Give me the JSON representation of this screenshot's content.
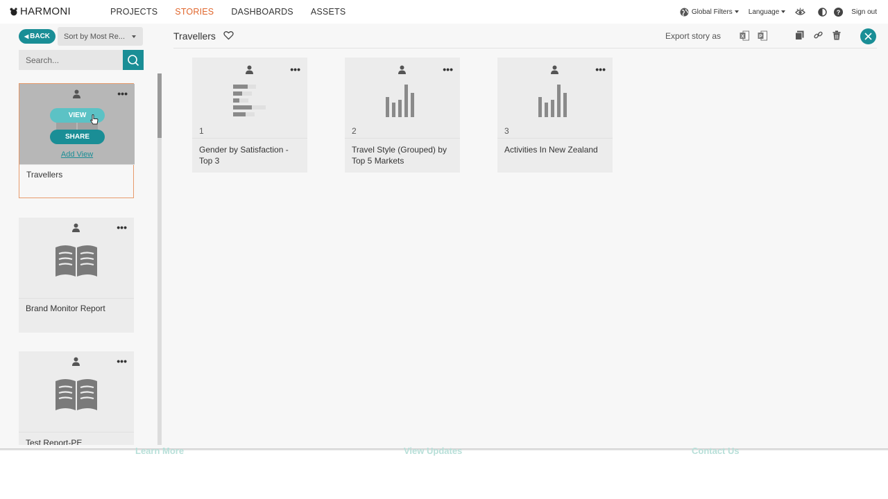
{
  "app": {
    "brand": "HARMONI"
  },
  "nav": {
    "links": [
      "PROJECTS",
      "STORIES",
      "DASHBOARDS",
      "ASSETS"
    ],
    "active": "STORIES",
    "global_filters": "Global Filters",
    "language": "Language",
    "sign_out": "Sign out"
  },
  "sidebar": {
    "back_label": "BACK",
    "sort_label": "Sort by Most Re...",
    "search_placeholder": "Search...",
    "stories": [
      {
        "title": "Travellers",
        "selected": true,
        "view_label": "VIEW",
        "share_label": "SHARE",
        "add_view_label": "Add View"
      },
      {
        "title": "Brand Monitor Report",
        "selected": false
      },
      {
        "title": "Test Report-PE",
        "selected": false
      }
    ]
  },
  "story": {
    "title": "Travellers",
    "export_label": "Export story as",
    "views": [
      {
        "number": "1",
        "title": "Gender by Satisfaction - Top 3",
        "icon": "horizontal-bar-chart-icon"
      },
      {
        "number": "2",
        "title": "Travel Style (Grouped) by Top 5 Markets",
        "icon": "vertical-bar-chart-icon"
      },
      {
        "number": "3",
        "title": "Activities In New Zealand",
        "icon": "vertical-bar-chart-icon"
      }
    ]
  },
  "footer": {
    "links": [
      "Learn More",
      "View Updates",
      "Contact Us"
    ]
  },
  "colors": {
    "accent": "#1a8e96",
    "active_nav": "#e0662c",
    "selected_border": "#e79a6b"
  }
}
